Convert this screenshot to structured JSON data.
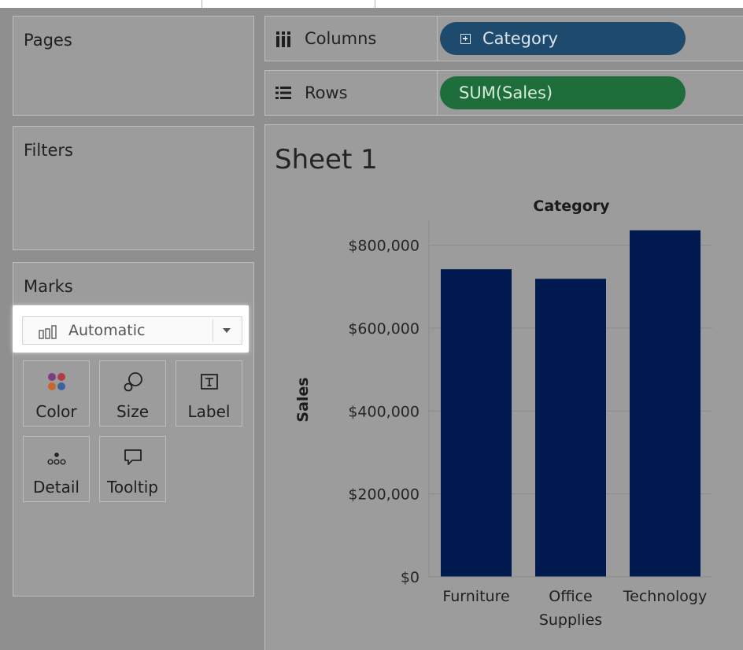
{
  "shelves": {
    "pages": "Pages",
    "filters": "Filters",
    "marks": "Marks",
    "columns_label": "Columns",
    "rows_label": "Rows",
    "columns_pill": "Category",
    "rows_pill": "SUM(Sales)"
  },
  "marks_card": {
    "type_value": "Automatic",
    "buttons": [
      "Color",
      "Size",
      "Label",
      "Detail",
      "Tooltip"
    ]
  },
  "sheet": {
    "title": "Sheet 1"
  },
  "colors": {
    "bar": "#001a4f",
    "columns_pill": "#1d4a6d",
    "rows_pill": "#1d6e3a"
  },
  "chart_data": {
    "type": "bar",
    "title": "Category",
    "ylabel": "Sales",
    "xlabel": "",
    "categories": [
      "Furniture",
      "Office Supplies",
      "Technology"
    ],
    "category_lines": [
      [
        "Furniture"
      ],
      [
        "Office",
        "Supplies"
      ],
      [
        "Technology"
      ]
    ],
    "values": [
      742000,
      719000,
      836000
    ],
    "ylim": [
      0,
      860000
    ],
    "yticks": [
      0,
      200000,
      400000,
      600000,
      800000
    ],
    "ytick_labels": [
      "$0",
      "$200,000",
      "$400,000",
      "$600,000",
      "$800,000"
    ],
    "grid": true
  }
}
